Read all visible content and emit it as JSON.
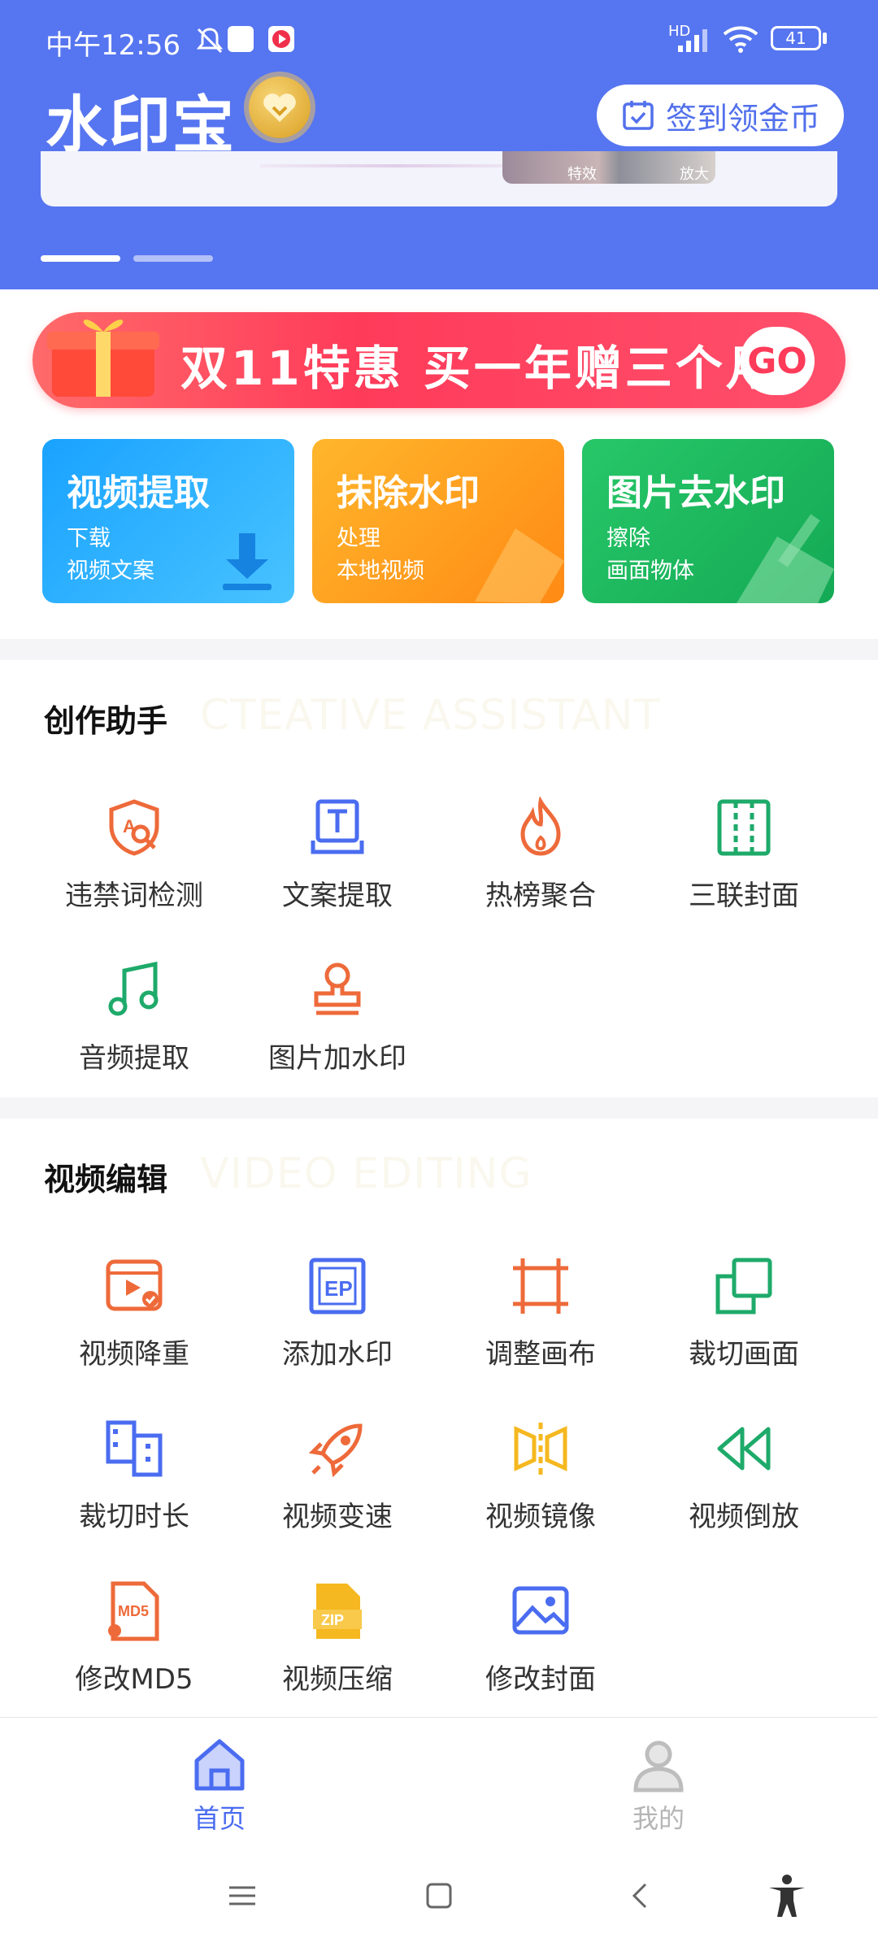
{
  "status": {
    "time": "中午12:56",
    "network": "HD",
    "battery": "41"
  },
  "header": {
    "app_title": "水印宝",
    "checkin_label": "签到领金币",
    "banner_tags": [
      "特效",
      "放大"
    ]
  },
  "promo": {
    "text": "双11特惠 买一年赠三个月",
    "go_label": "GO"
  },
  "features": [
    {
      "title": "视频提取",
      "line1": "下载",
      "line2": "视频文案",
      "color": "#1ea4ff"
    },
    {
      "title": "抹除水印",
      "line1": "处理",
      "line2": "本地视频",
      "color": "#ffa21c"
    },
    {
      "title": "图片去水印",
      "line1": "擦除",
      "line2": "画面物体",
      "color": "#1fbf63"
    }
  ],
  "creative": {
    "title": "创作助手",
    "subtitle": "CTEATIVE ASSISTANT",
    "tools": [
      {
        "label": "违禁词检测",
        "icon": "shield-search-icon"
      },
      {
        "label": "文案提取",
        "icon": "text-extract-icon"
      },
      {
        "label": "热榜聚合",
        "icon": "flame-icon"
      },
      {
        "label": "三联封面",
        "icon": "triple-cover-icon"
      },
      {
        "label": "音频提取",
        "icon": "music-note-icon"
      },
      {
        "label": "图片加水印",
        "icon": "stamp-icon"
      }
    ]
  },
  "video": {
    "title": "视频编辑",
    "subtitle": "VIDEO EDITING",
    "tools": [
      {
        "label": "视频降重",
        "icon": "video-check-icon"
      },
      {
        "label": "添加水印",
        "icon": "watermark-icon"
      },
      {
        "label": "调整画布",
        "icon": "crop-canvas-icon"
      },
      {
        "label": "裁切画面",
        "icon": "crop-frame-icon"
      },
      {
        "label": "裁切时长",
        "icon": "film-cut-icon"
      },
      {
        "label": "视频变速",
        "icon": "rocket-icon"
      },
      {
        "label": "视频镜像",
        "icon": "mirror-icon"
      },
      {
        "label": "视频倒放",
        "icon": "rewind-icon"
      },
      {
        "label": "修改MD5",
        "icon": "md5-file-icon"
      },
      {
        "label": "视频压缩",
        "icon": "zip-file-icon"
      },
      {
        "label": "修改封面",
        "icon": "image-icon"
      }
    ]
  },
  "nav": {
    "home_label": "首页",
    "mine_label": "我的",
    "active": "home"
  },
  "colors": {
    "brand": "#5675f0",
    "accent_orange": "#ee6a3a",
    "accent_blue": "#4a6cf0",
    "accent_green": "#1eaa6a",
    "accent_yellow": "#f5b820"
  }
}
